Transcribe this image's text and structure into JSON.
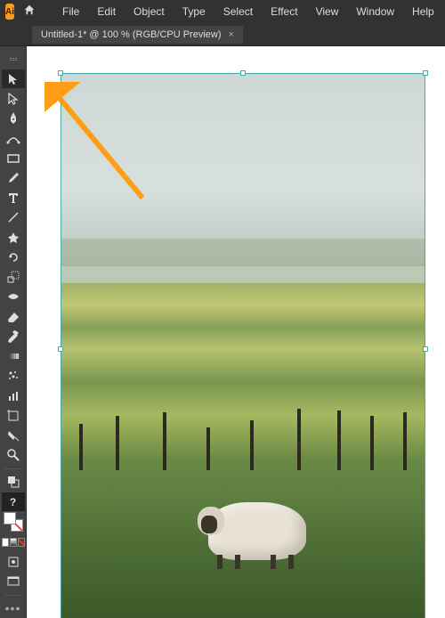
{
  "app": {
    "name": "Ai"
  },
  "menu": {
    "items": [
      "File",
      "Edit",
      "Object",
      "Type",
      "Select",
      "Effect",
      "View",
      "Window",
      "Help"
    ]
  },
  "tab": {
    "title": "Untitled-1* @ 100 % (RGB/CPU Preview)"
  },
  "tools": {
    "selection": "Selection Tool",
    "direct_selection": "Direct Selection Tool",
    "pen": "Pen Tool",
    "curvature": "Curvature Tool",
    "rectangle": "Rectangle Tool",
    "paintbrush": "Paintbrush Tool",
    "type": "Type Tool",
    "line": "Line Segment Tool",
    "shape": "Shape Tool",
    "rotate": "Rotate Tool",
    "scale": "Scale Tool",
    "width": "Width Tool",
    "eraser": "Eraser Tool",
    "eyedropper": "Eyedropper Tool",
    "gradient": "Gradient Tool",
    "symbol": "Symbol Sprayer Tool",
    "graph": "Column Graph Tool",
    "artboard": "Artboard Tool",
    "slice": "Slice Tool",
    "zoom": "Zoom Tool"
  },
  "annotation": {
    "arrow_color": "#ff9e16"
  }
}
